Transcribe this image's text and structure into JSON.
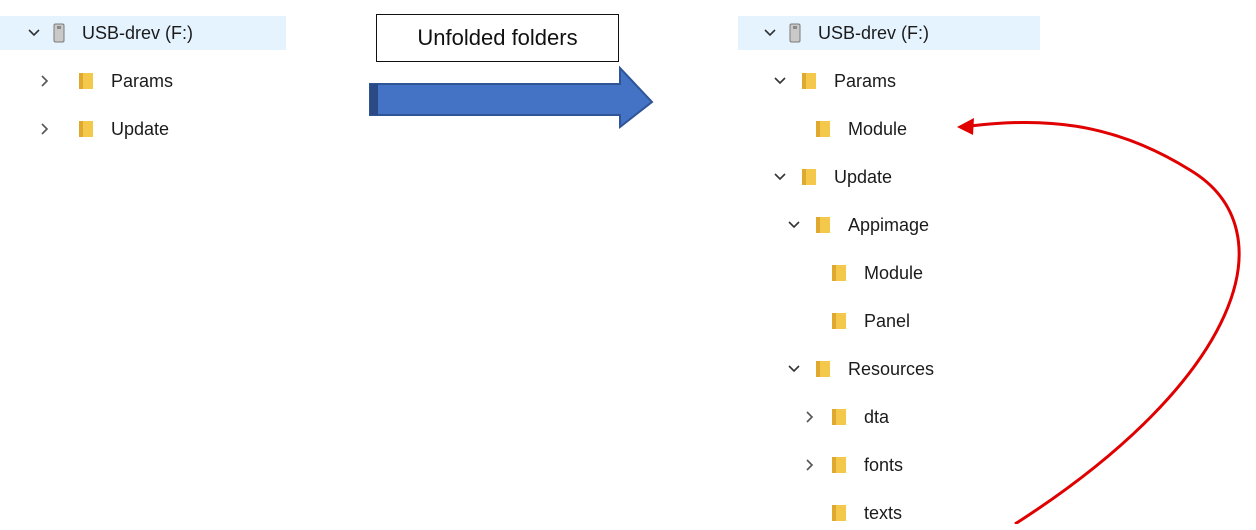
{
  "left_tree": {
    "drive": {
      "label": "USB-drev (F:)",
      "icon": "usb-drive-icon",
      "expanded": true
    },
    "folders": [
      {
        "label": "Params",
        "icon": "folder-icon",
        "expanded": false
      },
      {
        "label": "Update",
        "icon": "folder-icon",
        "expanded": false
      }
    ]
  },
  "annotation": {
    "text": "Unfolded folders",
    "arrow_color": "#4472c4",
    "link_color": "#e00000"
  },
  "right_tree": {
    "drive": {
      "label": "USB-drev (F:)",
      "icon": "usb-drive-icon",
      "expanded": true
    },
    "items": [
      {
        "label": "Params",
        "level": 1,
        "chevron": "down"
      },
      {
        "label": "Module",
        "level": 2,
        "chevron": "none"
      },
      {
        "label": "Update",
        "level": 1,
        "chevron": "down"
      },
      {
        "label": "Appimage",
        "level": 2,
        "chevron": "down"
      },
      {
        "label": "Module",
        "level": 3,
        "chevron": "none"
      },
      {
        "label": "Panel",
        "level": 3,
        "chevron": "none"
      },
      {
        "label": "Resources",
        "level": 2,
        "chevron": "down"
      },
      {
        "label": "dta",
        "level": 3,
        "chevron": "right"
      },
      {
        "label": "fonts",
        "level": 3,
        "chevron": "right"
      },
      {
        "label": "texts",
        "level": 3,
        "chevron": "none"
      }
    ]
  },
  "colors": {
    "selected_bg": "#e5f3ff",
    "folder_fill": "#f4c84a",
    "folder_dark": "#e0a82e"
  }
}
